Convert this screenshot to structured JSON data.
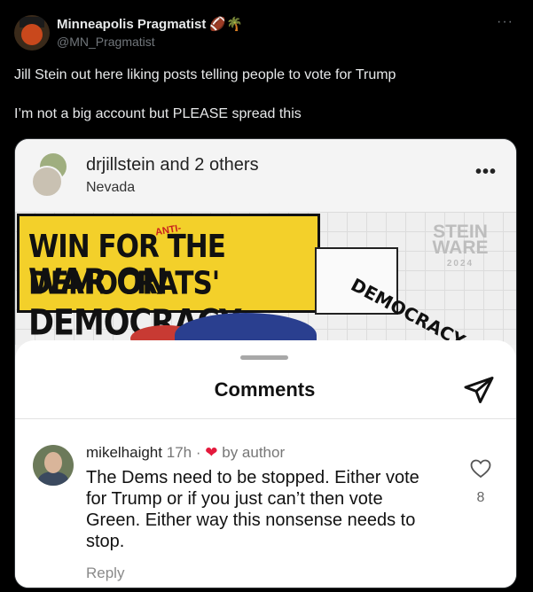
{
  "tweet": {
    "display_name": "Minneapolis Pragmatist",
    "name_emojis": "🏈🌴",
    "handle": "@MN_Pragmatist",
    "more": "···",
    "text": "Jill Stein out here liking posts telling people to vote for Trump\n\nI’m not a big account but PLEASE spread this"
  },
  "card": {
    "user": "drjillstein",
    "user_suffix": " and ",
    "others": "2 others",
    "location": "Nevada",
    "more": "•••",
    "graphic": {
      "banner_line1": "WIN FOR THE DEMOCRATS'",
      "banner_line2": "WAR ON DEMOCRACY",
      "stamp": "ANTI-",
      "stein_brand": "STEIN",
      "stein_brand2": "WARE",
      "stein_year": "2024",
      "democracy": "DEMOCRACY"
    }
  },
  "comments": {
    "title": "Comments",
    "comment": {
      "username": "mikelhaight",
      "time": "17h",
      "separator": "·",
      "heart": "❤",
      "by_author": "by author",
      "body": "The Dems need to be stopped. Either vote for Trump or if you just can’t then vote Green. Either way this nonsense needs to stop.",
      "reply": "Reply",
      "like_count": "8"
    }
  },
  "colors": {
    "background": "#000000",
    "banner_yellow": "#f3d02a",
    "heart_red": "#e4193c"
  }
}
